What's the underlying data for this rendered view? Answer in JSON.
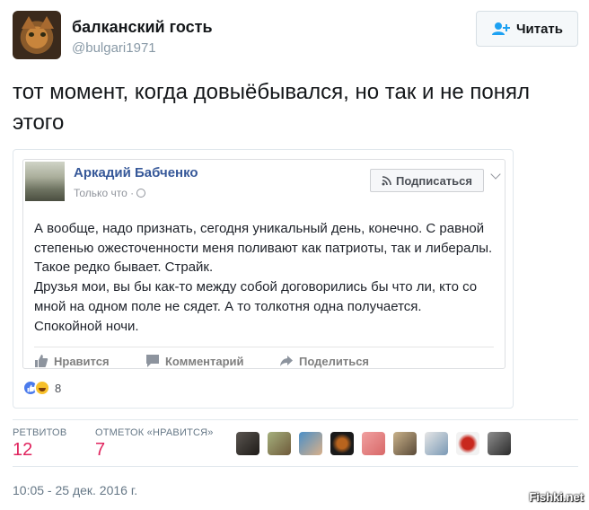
{
  "tweet": {
    "author_name": "балканский гость",
    "handle": "@bulgari1971",
    "follow_label": "Читать",
    "text": "тот момент, когда довыёбывался, но так и не понял этого",
    "retweets_label": "РЕТВИТОВ",
    "retweets_count": "12",
    "likes_label": "ОТМЕТОК «НРАВИТСЯ»",
    "likes_count": "7",
    "timestamp": "10:05 - 25 дек. 2016 г.",
    "likers_count_shown": 9
  },
  "fb_post": {
    "author": "Аркадий Бабченко",
    "time": "Только что ·",
    "subscribe_label": "Подписаться",
    "text": "А вообще, надо признать, сегодня уникальный день, конечно. С равной степенью ожесточенности меня поливают как патриоты, так и либералы. Такое редко бывает. Страйк.\nДрузья мои, вы бы как-то между собой договорились бы что ли, кто со мной на одном поле не сядет. А то толкотня одна получается.\nСпокойной ночи.",
    "actions": {
      "like": "Нравится",
      "comment": "Комментарий",
      "share": "Поделиться"
    },
    "reaction_count": "8"
  },
  "watermark": "Fishki.net",
  "colors": {
    "accent": "#e0245e",
    "fb_link": "#365899",
    "muted": "#657786"
  }
}
